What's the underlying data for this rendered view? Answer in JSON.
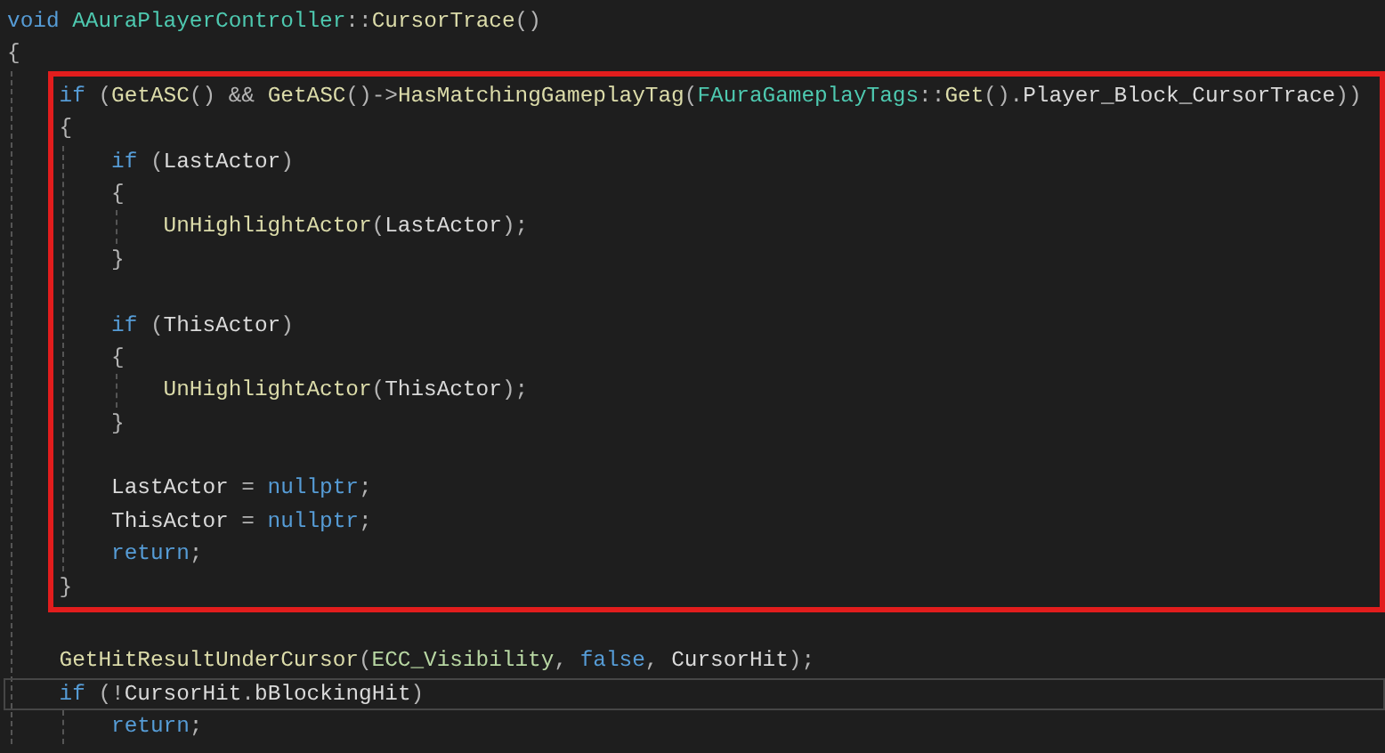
{
  "editor": {
    "lines": [
      {
        "kind": "line",
        "current": false,
        "tokens": [
          {
            "text": "void ",
            "kind": "keyword"
          },
          {
            "text": "AAuraPlayerController",
            "kind": "type"
          },
          {
            "text": "::",
            "kind": "punct"
          },
          {
            "text": "CursorTrace",
            "kind": "function"
          },
          {
            "text": "()",
            "kind": "punct"
          }
        ]
      },
      {
        "kind": "line",
        "current": false,
        "tokens": [
          {
            "text": "{",
            "kind": "punct"
          }
        ]
      },
      {
        "kind": "block",
        "children": [
          {
            "kind": "highlight",
            "children": [
              {
                "kind": "line",
                "current": false,
                "tokens": [
                  {
                    "text": "if",
                    "kind": "keyword"
                  },
                  {
                    "text": " (",
                    "kind": "punct"
                  },
                  {
                    "text": "GetASC",
                    "kind": "function"
                  },
                  {
                    "text": "() && ",
                    "kind": "punct"
                  },
                  {
                    "text": "GetASC",
                    "kind": "function"
                  },
                  {
                    "text": "()->",
                    "kind": "punct"
                  },
                  {
                    "text": "HasMatchingGameplayTag",
                    "kind": "function"
                  },
                  {
                    "text": "(",
                    "kind": "punct"
                  },
                  {
                    "text": "FAuraGameplayTags",
                    "kind": "type"
                  },
                  {
                    "text": "::",
                    "kind": "punct"
                  },
                  {
                    "text": "Get",
                    "kind": "function"
                  },
                  {
                    "text": "().",
                    "kind": "punct"
                  },
                  {
                    "text": "Player_Block_CursorTrace",
                    "kind": "variable"
                  },
                  {
                    "text": "))",
                    "kind": "punct"
                  }
                ]
              },
              {
                "kind": "line",
                "current": false,
                "tokens": [
                  {
                    "text": "{",
                    "kind": "punct"
                  }
                ]
              },
              {
                "kind": "block",
                "children": [
                  {
                    "kind": "line",
                    "current": false,
                    "tokens": [
                      {
                        "text": "if",
                        "kind": "keyword"
                      },
                      {
                        "text": " (",
                        "kind": "punct"
                      },
                      {
                        "text": "LastActor",
                        "kind": "variable"
                      },
                      {
                        "text": ")",
                        "kind": "punct"
                      }
                    ]
                  },
                  {
                    "kind": "line",
                    "current": false,
                    "tokens": [
                      {
                        "text": "{",
                        "kind": "punct"
                      }
                    ]
                  },
                  {
                    "kind": "block",
                    "children": [
                      {
                        "kind": "line",
                        "current": false,
                        "tokens": [
                          {
                            "text": "UnHighlightActor",
                            "kind": "function"
                          },
                          {
                            "text": "(",
                            "kind": "punct"
                          },
                          {
                            "text": "LastActor",
                            "kind": "variable"
                          },
                          {
                            "text": ");",
                            "kind": "punct"
                          }
                        ]
                      }
                    ]
                  },
                  {
                    "kind": "line",
                    "current": false,
                    "tokens": [
                      {
                        "text": "}",
                        "kind": "punct"
                      }
                    ]
                  },
                  {
                    "kind": "blank"
                  },
                  {
                    "kind": "line",
                    "current": false,
                    "tokens": [
                      {
                        "text": "if",
                        "kind": "keyword"
                      },
                      {
                        "text": " (",
                        "kind": "punct"
                      },
                      {
                        "text": "ThisActor",
                        "kind": "variable"
                      },
                      {
                        "text": ")",
                        "kind": "punct"
                      }
                    ]
                  },
                  {
                    "kind": "line",
                    "current": false,
                    "tokens": [
                      {
                        "text": "{",
                        "kind": "punct"
                      }
                    ]
                  },
                  {
                    "kind": "block",
                    "children": [
                      {
                        "kind": "line",
                        "current": false,
                        "tokens": [
                          {
                            "text": "UnHighlightActor",
                            "kind": "function"
                          },
                          {
                            "text": "(",
                            "kind": "punct"
                          },
                          {
                            "text": "ThisActor",
                            "kind": "variable"
                          },
                          {
                            "text": ");",
                            "kind": "punct"
                          }
                        ]
                      }
                    ]
                  },
                  {
                    "kind": "line",
                    "current": false,
                    "tokens": [
                      {
                        "text": "}",
                        "kind": "punct"
                      }
                    ]
                  },
                  {
                    "kind": "blank"
                  },
                  {
                    "kind": "line",
                    "current": false,
                    "tokens": [
                      {
                        "text": "LastActor",
                        "kind": "variable"
                      },
                      {
                        "text": " = ",
                        "kind": "punct"
                      },
                      {
                        "text": "nullptr",
                        "kind": "keyword"
                      },
                      {
                        "text": ";",
                        "kind": "punct"
                      }
                    ]
                  },
                  {
                    "kind": "line",
                    "current": false,
                    "tokens": [
                      {
                        "text": "ThisActor",
                        "kind": "variable"
                      },
                      {
                        "text": " = ",
                        "kind": "punct"
                      },
                      {
                        "text": "nullptr",
                        "kind": "keyword"
                      },
                      {
                        "text": ";",
                        "kind": "punct"
                      }
                    ]
                  },
                  {
                    "kind": "line",
                    "current": false,
                    "tokens": [
                      {
                        "text": "return",
                        "kind": "keyword"
                      },
                      {
                        "text": ";",
                        "kind": "punct"
                      }
                    ]
                  }
                ]
              },
              {
                "kind": "line",
                "current": false,
                "tokens": [
                  {
                    "text": "}",
                    "kind": "punct"
                  }
                ]
              }
            ]
          },
          {
            "kind": "blank"
          },
          {
            "kind": "line",
            "current": false,
            "tokens": [
              {
                "text": "GetHitResultUnderCursor",
                "kind": "function"
              },
              {
                "text": "(",
                "kind": "punct"
              },
              {
                "text": "ECC_Visibility",
                "kind": "enum"
              },
              {
                "text": ", ",
                "kind": "punct"
              },
              {
                "text": "false",
                "kind": "keyword"
              },
              {
                "text": ", ",
                "kind": "punct"
              },
              {
                "text": "CursorHit",
                "kind": "variable"
              },
              {
                "text": ");",
                "kind": "punct"
              }
            ]
          },
          {
            "kind": "line",
            "current": true,
            "tokens": [
              {
                "text": "if",
                "kind": "keyword"
              },
              {
                "text": " (!",
                "kind": "punct"
              },
              {
                "text": "CursorHit",
                "kind": "variable"
              },
              {
                "text": ".",
                "kind": "punct"
              },
              {
                "text": "bBlockingHit",
                "kind": "variable"
              },
              {
                "text": ")",
                "kind": "punct"
              }
            ]
          },
          {
            "kind": "block",
            "children": [
              {
                "kind": "line",
                "current": false,
                "tokens": [
                  {
                    "text": "return",
                    "kind": "keyword"
                  },
                  {
                    "text": ";",
                    "kind": "punct"
                  }
                ]
              }
            ]
          }
        ]
      }
    ]
  }
}
